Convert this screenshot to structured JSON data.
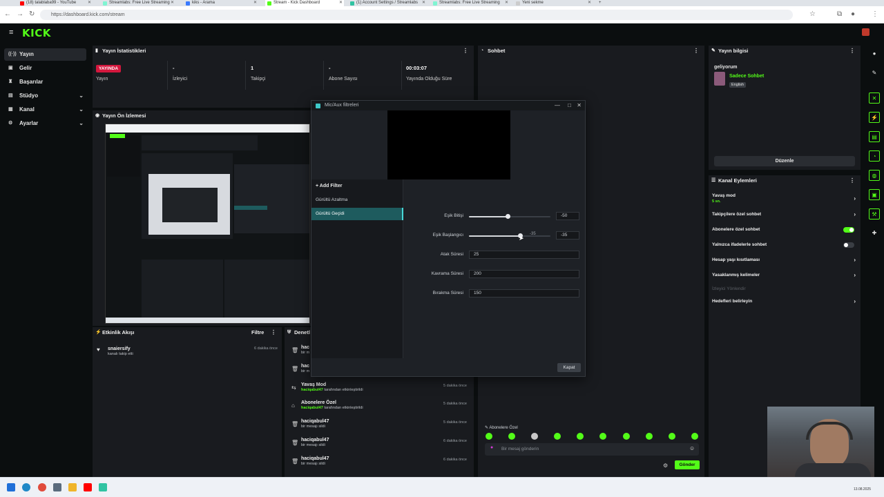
{
  "browser": {
    "tabs": [
      {
        "title": "(18) talablaba99 - YouTube",
        "color": "#ff0000"
      },
      {
        "title": "Streamlabs: Free Live Streaming",
        "color": "#80f5d2"
      },
      {
        "title": "kiks - Arama",
        "color": "#3a7afe"
      },
      {
        "title": "Stream - Kick Dashboard",
        "color": "#53fc18"
      },
      {
        "title": "(1) Account Settings / Streamlabs",
        "color": "#31c3a2"
      },
      {
        "title": "Streamlabs: Free Live Streaming",
        "color": "#80f5d2"
      },
      {
        "title": "Yeni sekme",
        "color": "#cccccc"
      }
    ],
    "url": "https://dashboard.kick.com/stream"
  },
  "brand": {
    "logo": "KICK",
    "accent": "#53fc18"
  },
  "sidebar": {
    "items": [
      {
        "label": "Yayın",
        "icon": "broadcast-icon"
      },
      {
        "label": "Gelir",
        "icon": "money-icon"
      },
      {
        "label": "Başarılar",
        "icon": "trophy-icon"
      },
      {
        "label": "Stüdyo",
        "icon": "studio-icon"
      },
      {
        "label": "Kanal",
        "icon": "channel-icon"
      },
      {
        "label": "Ayarlar",
        "icon": "gear-icon"
      }
    ]
  },
  "stats": {
    "title": "Yayın İstatistikleri",
    "badge": "YAYINDA",
    "status_label": "Yayın",
    "viewers": {
      "value": "-",
      "label": "İzleyici"
    },
    "followers": {
      "value": "1",
      "label": "Takipçi"
    },
    "subs": {
      "value": "-",
      "label": "Abone Sayısı"
    },
    "uptime": {
      "value": "00:03:07",
      "label": "Yayında Olduğu Süre"
    }
  },
  "preview": {
    "title": "Yayın Ön İzlemesi"
  },
  "chat": {
    "title": "Sohbet",
    "mode_label": "Abonelere Özel",
    "placeholder": "Bir mesaj gönderin",
    "send": "Gönder"
  },
  "stream_info": {
    "title": "Yayın bilgisi",
    "stream_title": "geliyorum",
    "category": "Sadece Sohbet",
    "language": "English",
    "edit": "Düzenle"
  },
  "channel_actions": {
    "title": "Kanal Eylemleri",
    "slow_mode": "Yavaş mod",
    "slow_mode_value": "5 sn.",
    "followers_only": "Takipçilere özel sohbet",
    "subs_only": "Abonelere özel sohbet",
    "emotes_only": "Yalnızca ifadelerle sohbet",
    "account_age": "Hesap yaşı kısıtlaması",
    "banned_words": "Yasaklanmış kelimeler",
    "viewer_redirect": "İzleyici Yönlendir",
    "target_goals": "Hedefleri belirleyin"
  },
  "activity": {
    "title": "Etkinlik Akışı",
    "filter": "Filtre",
    "items": [
      {
        "user": "snaiersify",
        "action": "kanalı takip etti",
        "time": "6 dakika önce"
      }
    ]
  },
  "moderation": {
    "title": "Denetl",
    "partial": [
      {
        "title": "hac",
        "sub": "bir m"
      },
      {
        "title": "hac",
        "sub": "bir m"
      }
    ],
    "items": [
      {
        "title": "Yavaş Mod",
        "user": "haciqabul47",
        "sub": "tarafından etkinleştirildi",
        "time": "5 dakika önce",
        "icon": "slow-icon"
      },
      {
        "title": "Abonelere Özel",
        "user": "haciqabul47",
        "sub": "tarafından etkinleştirildi",
        "time": "5 dakika önce",
        "icon": "gift-icon"
      },
      {
        "title": "haciqabul47",
        "user": "",
        "sub": "bir mesajı sildi",
        "time": "5 dakika önce",
        "icon": "trash-icon"
      },
      {
        "title": "haciqabul47",
        "user": "",
        "sub": "bir mesajı sildi",
        "time": "6 dakika önce",
        "icon": "trash-icon"
      },
      {
        "title": "haciqabul47",
        "user": "",
        "sub": "bir mesajı sildi",
        "time": "6 dakika önce",
        "icon": "trash-icon"
      }
    ]
  },
  "modal": {
    "title": "Mic/Aux filtreleri",
    "add_filter": "Add Filter",
    "filters": [
      "Gürültü Azaltma",
      "Gürültü Geçidi"
    ],
    "selected_filter": 1,
    "props": {
      "close_threshold": {
        "label": "Eşik Bitişi",
        "value": "-50",
        "fraction": 0.48
      },
      "open_threshold": {
        "label": "Eşik Başlangıcı",
        "value": "-35",
        "hover": "-35",
        "fraction": 0.63
      },
      "attack": {
        "label": "Atak Süresi",
        "value": "25"
      },
      "hold": {
        "label": "Kavrama Süresi",
        "value": "200"
      },
      "release": {
        "label": "Bırakma Süresi",
        "value": "150"
      }
    },
    "close": "Kapat"
  },
  "taskbar": {
    "clock": "13.08.2025"
  }
}
